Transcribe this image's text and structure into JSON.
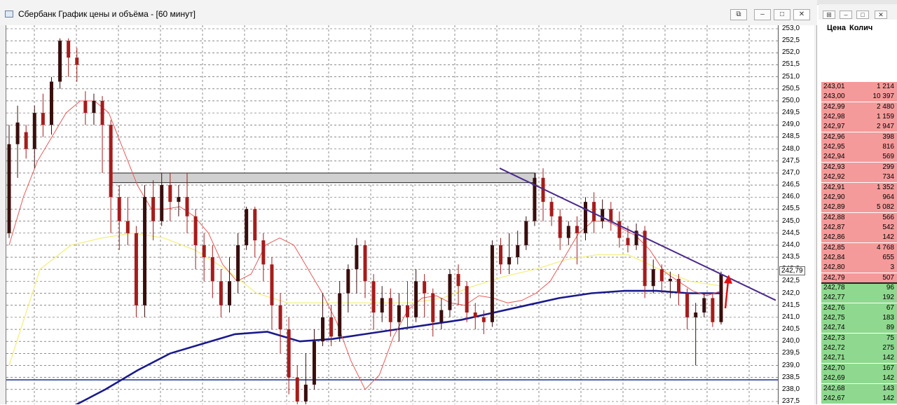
{
  "window": {
    "title": "Сбербанк График цены и объёма - [60 минут]",
    "buttons": {
      "restore": "⧉",
      "minimize": "–",
      "maximize": "□",
      "close": "✕"
    }
  },
  "chart_data": {
    "type": "candlestick",
    "title": "",
    "xlabel": "",
    "ylabel": "",
    "ylim": [
      237.5,
      253.0
    ],
    "y_ticks": [
      "253,0",
      "252,5",
      "252,0",
      "251,5",
      "251,0",
      "250,5",
      "250,0",
      "249,5",
      "249,0",
      "248,5",
      "248,0",
      "247,5",
      "247,0",
      "246,5",
      "246,0",
      "245,5",
      "245,0",
      "244,5",
      "244,0",
      "243,5",
      "243,0",
      "242,5",
      "242,0",
      "241,5",
      "241,0",
      "240,5",
      "240,0",
      "239,5",
      "239,0",
      "238,5",
      "238,0",
      "237,5"
    ],
    "last_price_label": "242,79",
    "grid": true,
    "colors": {
      "up": "#3a0e0e",
      "down": "#a51c1c",
      "ma_fast": "#e85a5a",
      "ma_mid": "#f4f08a",
      "ma_slow": "#1a1a8c",
      "trend": "#4a2a8c",
      "support": "#1e2e8c",
      "arrow": "#e01010",
      "resistance_zone": "#d0d0d0"
    },
    "candles": [
      [
        244.5,
        248.2,
        244.3,
        249.0
      ],
      [
        248.2,
        249.1,
        246.8,
        249.8
      ],
      [
        248.7,
        248.0,
        247.6,
        249.0
      ],
      [
        248.0,
        249.5,
        247.2,
        249.8
      ],
      [
        249.5,
        249.0,
        248.5,
        250.3
      ],
      [
        249.0,
        250.8,
        248.6,
        251.0
      ],
      [
        250.8,
        252.5,
        250.5,
        252.6
      ],
      [
        252.5,
        251.8,
        251.0,
        252.6
      ],
      [
        251.8,
        251.5,
        250.8,
        252.2
      ],
      [
        250.0,
        249.5,
        249.0,
        250.4
      ],
      [
        249.5,
        250.0,
        249.0,
        250.3
      ],
      [
        250.0,
        249.0,
        247.0,
        250.2
      ],
      [
        249.0,
        246.0,
        244.5,
        249.2
      ],
      [
        246.0,
        245.0,
        243.8,
        246.5
      ],
      [
        245.0,
        244.5,
        244.0,
        246.0
      ],
      [
        244.5,
        241.5,
        241.0,
        244.8
      ],
      [
        241.5,
        246.0,
        241.0,
        246.5
      ],
      [
        246.0,
        245.0,
        244.2,
        246.7
      ],
      [
        245.0,
        246.5,
        244.8,
        247.0
      ],
      [
        246.5,
        245.8,
        245.0,
        247.0
      ],
      [
        245.8,
        246.0,
        245.2,
        246.5
      ],
      [
        246.0,
        245.2,
        244.5,
        247.0
      ],
      [
        245.2,
        244.0,
        243.0,
        245.5
      ],
      [
        244.0,
        243.5,
        242.5,
        244.5
      ],
      [
        243.5,
        242.5,
        241.8,
        244.0
      ],
      [
        242.5,
        241.5,
        241.0,
        243.0
      ],
      [
        241.5,
        242.5,
        241.2,
        243.5
      ],
      [
        242.5,
        244.0,
        242.0,
        244.5
      ],
      [
        244.0,
        245.5,
        243.8,
        245.6
      ],
      [
        245.5,
        244.2,
        243.5,
        245.6
      ],
      [
        244.2,
        243.2,
        242.5,
        244.5
      ],
      [
        243.2,
        241.5,
        240.5,
        243.5
      ],
      [
        241.5,
        240.5,
        239.5,
        242.0
      ],
      [
        240.5,
        238.5,
        237.8,
        241.0
      ],
      [
        238.5,
        237.5,
        237.3,
        239.0
      ],
      [
        237.5,
        238.2,
        237.3,
        239.5
      ],
      [
        238.2,
        240.0,
        238.0,
        240.5
      ],
      [
        240.0,
        241.0,
        239.8,
        242.0
      ],
      [
        241.0,
        240.2,
        239.8,
        241.5
      ],
      [
        240.2,
        242.0,
        240.0,
        242.5
      ],
      [
        242.0,
        243.0,
        241.2,
        243.2
      ],
      [
        243.0,
        244.0,
        242.0,
        244.3
      ],
      [
        244.0,
        242.5,
        241.8,
        244.2
      ],
      [
        242.5,
        241.2,
        240.5,
        242.8
      ],
      [
        241.2,
        241.8,
        240.8,
        242.3
      ],
      [
        241.8,
        240.8,
        240.2,
        242.2
      ],
      [
        240.8,
        241.5,
        240.0,
        242.0
      ],
      [
        241.5,
        241.0,
        240.5,
        242.5
      ],
      [
        241.0,
        242.5,
        240.8,
        243.0
      ],
      [
        242.5,
        242.0,
        241.0,
        242.8
      ],
      [
        242.0,
        240.8,
        240.2,
        242.2
      ],
      [
        240.8,
        241.3,
        240.5,
        241.8
      ],
      [
        241.3,
        242.8,
        241.0,
        243.0
      ],
      [
        242.8,
        242.3,
        241.5,
        243.2
      ],
      [
        242.3,
        241.2,
        240.8,
        242.5
      ],
      [
        241.2,
        241.0,
        240.5,
        241.6
      ],
      [
        241.0,
        240.8,
        240.3,
        241.3
      ],
      [
        240.8,
        244.0,
        240.6,
        244.2
      ],
      [
        244.0,
        243.2,
        242.8,
        244.3
      ],
      [
        243.2,
        243.5,
        242.8,
        244.5
      ],
      [
        243.5,
        244.0,
        243.2,
        244.6
      ],
      [
        244.0,
        245.0,
        243.8,
        245.2
      ],
      [
        245.0,
        246.8,
        244.8,
        247.0
      ],
      [
        246.8,
        245.8,
        245.0,
        247.2
      ],
      [
        245.8,
        245.2,
        244.8,
        246.0
      ],
      [
        245.2,
        244.3,
        243.8,
        245.5
      ],
      [
        244.3,
        244.8,
        244.0,
        245.0
      ],
      [
        244.8,
        244.5,
        243.2,
        245.2
      ],
      [
        244.5,
        245.8,
        244.2,
        246.0
      ],
      [
        245.8,
        245.0,
        244.5,
        246.2
      ],
      [
        245.0,
        245.5,
        244.7,
        245.9
      ],
      [
        245.5,
        245.0,
        244.6,
        245.8
      ],
      [
        245.0,
        244.3,
        243.9,
        245.4
      ],
      [
        244.3,
        244.0,
        243.7,
        244.8
      ],
      [
        244.0,
        244.6,
        243.8,
        244.9
      ],
      [
        244.6,
        242.3,
        241.8,
        244.8
      ],
      [
        242.3,
        243.0,
        242.0,
        243.4
      ],
      [
        243.0,
        242.5,
        242.0,
        243.2
      ],
      [
        242.5,
        242.6,
        241.8,
        242.9
      ],
      [
        242.6,
        242.0,
        241.5,
        242.8
      ],
      [
        242.0,
        241.0,
        240.5,
        242.2
      ],
      [
        241.0,
        241.2,
        239.0,
        241.6
      ],
      [
        241.2,
        241.8,
        241.0,
        242.0
      ],
      [
        241.8,
        240.8,
        240.6,
        242.0
      ],
      [
        240.8,
        242.8,
        240.7,
        242.9
      ]
    ],
    "moving_averages": {
      "fast": [
        244.0,
        246.0,
        247.5,
        248.5,
        249.5,
        250.0,
        250.0,
        249.5,
        248.0,
        246.5,
        245.5,
        245.5,
        245.6,
        245.2,
        244.5,
        243.2,
        242.5,
        242.8,
        244.0,
        244.3,
        244.0,
        243.0,
        242.0,
        240.8,
        239.2,
        238.0,
        238.6,
        240.2,
        241.3,
        241.8,
        241.9,
        241.6,
        241.5,
        241.9,
        241.8,
        241.6,
        241.7,
        242.0,
        242.5,
        243.5,
        244.5,
        245.0,
        245.0,
        244.7,
        244.4,
        243.8,
        242.9,
        242.5,
        242.1,
        241.9,
        242.1
      ],
      "mid": [
        239.0,
        243.0,
        244.0,
        244.3,
        244.5,
        244.3,
        243.8,
        243.0,
        242.0,
        241.6,
        241.6,
        241.6,
        241.6,
        241.6,
        241.8,
        242.3,
        242.7,
        243.0,
        243.4,
        243.6,
        243.6,
        243.0,
        242.5,
        242.3
      ],
      "slow": [
        237.3,
        238.0,
        238.8,
        239.5,
        239.9,
        240.3,
        240.4,
        240.0,
        240.1,
        240.3,
        240.5,
        240.7,
        240.9,
        241.2,
        241.5,
        241.8,
        242.0,
        242.1,
        242.1,
        242.0,
        242.0
      ]
    },
    "trendline": [
      [
        247.2
      ],
      [
        242.0
      ]
    ],
    "support_level": 238.4,
    "resistance_zone": [
      246.6,
      247.0
    ]
  },
  "depth": {
    "headers": {
      "price": "Цена",
      "qty": "Колич"
    },
    "buttons": {
      "pin": "⊞",
      "minimize": "–",
      "restore": "□",
      "close": "✕"
    },
    "asks": [
      {
        "price": "243,01",
        "qty": "1 214"
      },
      {
        "price": "243,00",
        "qty": "10 397"
      },
      {
        "price": "242,99",
        "qty": "2 480"
      },
      {
        "price": "242,98",
        "qty": "1 159"
      },
      {
        "price": "242,97",
        "qty": "2 947"
      },
      {
        "price": "242,96",
        "qty": "398"
      },
      {
        "price": "242,95",
        "qty": "816"
      },
      {
        "price": "242,94",
        "qty": "569"
      },
      {
        "price": "242,93",
        "qty": "299"
      },
      {
        "price": "242,92",
        "qty": "734"
      },
      {
        "price": "242,91",
        "qty": "1 352"
      },
      {
        "price": "242,90",
        "qty": "964"
      },
      {
        "price": "242,89",
        "qty": "5 082"
      },
      {
        "price": "242,88",
        "qty": "566"
      },
      {
        "price": "242,87",
        "qty": "542"
      },
      {
        "price": "242,86",
        "qty": "142"
      },
      {
        "price": "242,85",
        "qty": "4 768"
      },
      {
        "price": "242,84",
        "qty": "655"
      },
      {
        "price": "242,80",
        "qty": "3"
      },
      {
        "price": "242,79",
        "qty": "507"
      }
    ],
    "bids": [
      {
        "price": "242,78",
        "qty": "96"
      },
      {
        "price": "242,77",
        "qty": "192"
      },
      {
        "price": "242,76",
        "qty": "67"
      },
      {
        "price": "242,75",
        "qty": "183"
      },
      {
        "price": "242,74",
        "qty": "89"
      },
      {
        "price": "242,73",
        "qty": "75"
      },
      {
        "price": "242,72",
        "qty": "275"
      },
      {
        "price": "242,71",
        "qty": "142"
      },
      {
        "price": "242,70",
        "qty": "167"
      },
      {
        "price": "242,69",
        "qty": "142"
      },
      {
        "price": "242,68",
        "qty": "143"
      },
      {
        "price": "242,67",
        "qty": "142"
      }
    ]
  }
}
